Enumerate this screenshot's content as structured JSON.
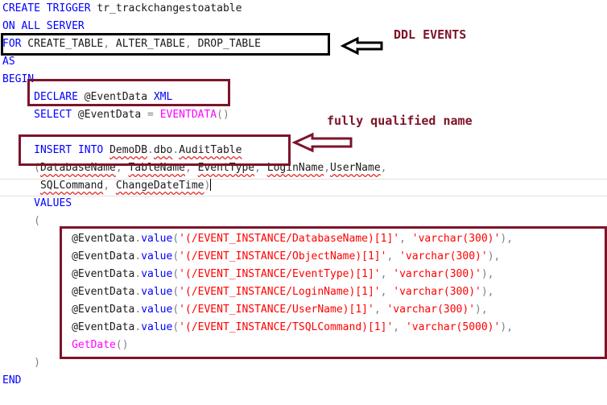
{
  "code_lines": [
    [
      {
        "t": "CREATE TRIGGER",
        "c": "kw"
      },
      {
        "t": " tr_trackchangestoatable",
        "c": "va"
      }
    ],
    [
      {
        "t": "ON ALL SERVER",
        "c": "kw"
      }
    ],
    [
      {
        "t": "FOR",
        "c": "kw"
      },
      {
        "t": " CREATE_TABLE",
        "c": "va"
      },
      {
        "t": ",",
        "c": "gr"
      },
      {
        "t": " ALTER_TABLE",
        "c": "va"
      },
      {
        "t": ",",
        "c": "gr"
      },
      {
        "t": " DROP_TABLE",
        "c": "va"
      }
    ],
    [
      {
        "t": "AS",
        "c": "kw"
      }
    ],
    [
      {
        "t": "BEGIN",
        "c": "kw"
      }
    ],
    [
      {
        "t": "     "
      },
      {
        "t": "DECLARE",
        "c": "kw"
      },
      {
        "t": " @EventData",
        "c": "va"
      },
      {
        "t": " XML",
        "c": "kw"
      }
    ],
    [
      {
        "t": "     "
      },
      {
        "t": "SELECT",
        "c": "kw"
      },
      {
        "t": " @EventData",
        "c": "va"
      },
      {
        "t": " =",
        "c": "gr"
      },
      {
        "t": " ",
        "c": "va"
      },
      {
        "t": "EVENTDATA",
        "c": "fn"
      },
      {
        "t": "()",
        "c": "gr"
      }
    ],
    [],
    [
      {
        "t": "     "
      },
      {
        "t": "INSERT",
        "c": "kw"
      },
      {
        "t": " ",
        "c": "va"
      },
      {
        "t": "INTO",
        "c": "kw"
      },
      {
        "t": " ",
        "c": "va"
      },
      {
        "t": "DemoDB",
        "c": "va",
        "s": true
      },
      {
        "t": ".",
        "c": "gr"
      },
      {
        "t": "dbo",
        "c": "va",
        "s": true
      },
      {
        "t": ".",
        "c": "gr"
      },
      {
        "t": "AuditTable",
        "c": "va",
        "s": true
      }
    ],
    [
      {
        "t": "     "
      },
      {
        "t": "(",
        "c": "gr"
      },
      {
        "t": "DatabaseName",
        "c": "va",
        "s": true
      },
      {
        "t": ",",
        "c": "gr"
      },
      {
        "t": " ",
        "c": "va"
      },
      {
        "t": "TableName",
        "c": "va",
        "s": true
      },
      {
        "t": ",",
        "c": "gr"
      },
      {
        "t": " ",
        "c": "va"
      },
      {
        "t": "EventType",
        "c": "va",
        "s": true
      },
      {
        "t": ",",
        "c": "gr"
      },
      {
        "t": " ",
        "c": "va"
      },
      {
        "t": "LoginName",
        "c": "va",
        "s": true
      },
      {
        "t": ",",
        "c": "gr"
      },
      {
        "t": "UserName",
        "c": "va",
        "s": true
      },
      {
        "t": ",",
        "c": "gr"
      }
    ],
    [
      {
        "t": "      "
      },
      {
        "t": "SQLCommand",
        "c": "va",
        "s": true
      },
      {
        "t": ",",
        "c": "gr"
      },
      {
        "t": " ",
        "c": "va"
      },
      {
        "t": "ChangeDateTime",
        "c": "va",
        "s": true
      },
      {
        "t": ")",
        "c": "gr",
        "caret": true
      }
    ],
    [
      {
        "t": "     "
      },
      {
        "t": "VALUES",
        "c": "kw"
      }
    ],
    [
      {
        "t": "     "
      },
      {
        "t": "(",
        "c": "gr"
      }
    ],
    [
      {
        "t": "           "
      },
      {
        "t": "@EventData",
        "c": "va"
      },
      {
        "t": ".",
        "c": "gr"
      },
      {
        "t": "value",
        "c": "kw"
      },
      {
        "t": "(",
        "c": "gr"
      },
      {
        "t": "'(/EVENT_INSTANCE/DatabaseName)[1]'",
        "c": "st"
      },
      {
        "t": ",",
        "c": "gr"
      },
      {
        "t": " ",
        "c": "va"
      },
      {
        "t": "'varchar(300)'",
        "c": "st"
      },
      {
        "t": "),",
        "c": "gr"
      }
    ],
    [
      {
        "t": "           "
      },
      {
        "t": "@EventData",
        "c": "va"
      },
      {
        "t": ".",
        "c": "gr"
      },
      {
        "t": "value",
        "c": "kw"
      },
      {
        "t": "(",
        "c": "gr"
      },
      {
        "t": "'(/EVENT_INSTANCE/ObjectName)[1]'",
        "c": "st"
      },
      {
        "t": ",",
        "c": "gr"
      },
      {
        "t": " ",
        "c": "va"
      },
      {
        "t": "'varchar(300)'",
        "c": "st"
      },
      {
        "t": "),",
        "c": "gr"
      }
    ],
    [
      {
        "t": "           "
      },
      {
        "t": "@EventData",
        "c": "va"
      },
      {
        "t": ".",
        "c": "gr"
      },
      {
        "t": "value",
        "c": "kw"
      },
      {
        "t": "(",
        "c": "gr"
      },
      {
        "t": "'(/EVENT_INSTANCE/EventType)[1]'",
        "c": "st"
      },
      {
        "t": ",",
        "c": "gr"
      },
      {
        "t": " ",
        "c": "va"
      },
      {
        "t": "'varchar(300)'",
        "c": "st"
      },
      {
        "t": "),",
        "c": "gr"
      }
    ],
    [
      {
        "t": "           "
      },
      {
        "t": "@EventData",
        "c": "va"
      },
      {
        "t": ".",
        "c": "gr"
      },
      {
        "t": "value",
        "c": "kw"
      },
      {
        "t": "(",
        "c": "gr"
      },
      {
        "t": "'(/EVENT_INSTANCE/LoginName)[1]'",
        "c": "st"
      },
      {
        "t": ",",
        "c": "gr"
      },
      {
        "t": " ",
        "c": "va"
      },
      {
        "t": "'varchar(300)'",
        "c": "st"
      },
      {
        "t": "),",
        "c": "gr"
      }
    ],
    [
      {
        "t": "           "
      },
      {
        "t": "@EventData",
        "c": "va"
      },
      {
        "t": ".",
        "c": "gr"
      },
      {
        "t": "value",
        "c": "kw"
      },
      {
        "t": "(",
        "c": "gr"
      },
      {
        "t": "'(/EVENT_INSTANCE/UserName)[1]'",
        "c": "st"
      },
      {
        "t": ",",
        "c": "gr"
      },
      {
        "t": " ",
        "c": "va"
      },
      {
        "t": "'varchar(300)'",
        "c": "st"
      },
      {
        "t": "),",
        "c": "gr"
      }
    ],
    [
      {
        "t": "           "
      },
      {
        "t": "@EventData",
        "c": "va"
      },
      {
        "t": ".",
        "c": "gr"
      },
      {
        "t": "value",
        "c": "kw"
      },
      {
        "t": "(",
        "c": "gr"
      },
      {
        "t": "'(/EVENT_INSTANCE/TSQLCommand)[1]'",
        "c": "st"
      },
      {
        "t": ",",
        "c": "gr"
      },
      {
        "t": " ",
        "c": "va"
      },
      {
        "t": "'varchar(5000)'",
        "c": "st"
      },
      {
        "t": "),",
        "c": "gr"
      }
    ],
    [
      {
        "t": "           "
      },
      {
        "t": "GetDate",
        "c": "fn"
      },
      {
        "t": "()",
        "c": "gr"
      }
    ],
    [
      {
        "t": "     "
      },
      {
        "t": ")",
        "c": "gr"
      }
    ],
    [
      {
        "t": "END",
        "c": "kw"
      }
    ]
  ],
  "annotations": {
    "ddl_events": "DDL EVENTS",
    "fully_qualified_name": "fully qualified name"
  },
  "colors": {
    "keyword": "#0000ff",
    "operator": "#808080",
    "function": "#ff00ff",
    "string": "#ff0000",
    "annotation_red": "#7d1429",
    "annotation_black": "#000000"
  },
  "icons": {
    "ddl_arrow": "left-arrow-icon",
    "name_arrow": "left-arrow-icon"
  }
}
